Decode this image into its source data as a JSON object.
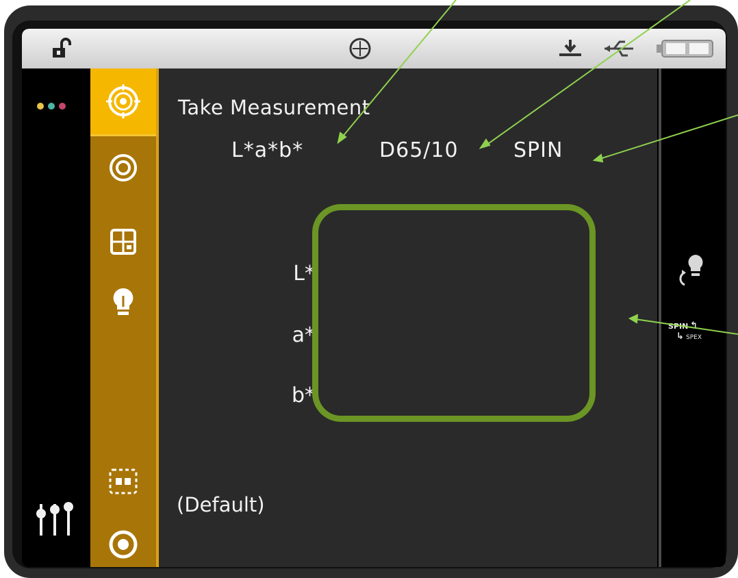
{
  "status_bar": {
    "icons": [
      "unlock-icon",
      "target-icon",
      "dock-icon",
      "usb-icon",
      "battery-icon"
    ]
  },
  "left_bar": {
    "dot_colors": [
      "#e8c34a",
      "#4fb3a8",
      "#c2456b"
    ],
    "icons": [
      "indicator-dots-icon",
      "sliders-icon"
    ]
  },
  "sidebar": {
    "accent_active": "#f5b700",
    "accent": "#a87508",
    "items": [
      "measure-target-icon",
      "concentric-circles-icon",
      "grid-icon",
      "bulb-icon",
      "dashed-select-icon",
      "ring-icon"
    ]
  },
  "main": {
    "title": "Take Measurement",
    "color_space": "L*a*b*",
    "illuminant": "D65/10",
    "mode": "SPIN",
    "labels": {
      "l": "L*",
      "a": "a*",
      "b": "b*"
    },
    "profile": "(Default)"
  },
  "right_bar": {
    "spin_label": "SPIN",
    "spex_label": "SPEX",
    "icons": [
      "bulb-cycle-icon",
      "spin-spex-toggle-icon"
    ]
  },
  "annotation": {
    "arrow_color": "#8fd14f",
    "box_color": "#6b9524"
  }
}
